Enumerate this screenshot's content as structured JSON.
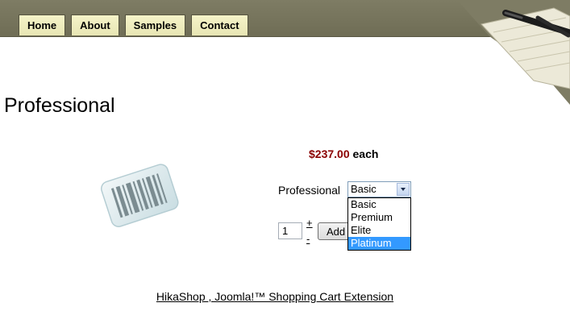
{
  "nav": {
    "items": [
      {
        "label": "Home"
      },
      {
        "label": "About"
      },
      {
        "label": "Samples"
      },
      {
        "label": "Contact"
      }
    ]
  },
  "page": {
    "title": "Professional"
  },
  "product": {
    "price": "$237.00",
    "price_suffix": "each",
    "variant_label": "Professional",
    "selected_variant": "Basic",
    "variant_options": [
      "Basic",
      "Premium",
      "Elite",
      "Platinum"
    ],
    "highlighted_option": "Platinum",
    "quantity": "1",
    "plus_label": "+",
    "minus_label": "-",
    "add_button_label": "Add to cart"
  },
  "footer": {
    "link_text": "HikaShop , Joomla!™ Shopping Cart Extension"
  },
  "colors": {
    "header_bg": "#7e7c64",
    "nav_tab_bg": "#f5f3c8",
    "price": "#8b0000",
    "option_highlight": "#3399ff"
  },
  "icons": {
    "header_art": "notepad-pen-icon",
    "product_image": "barcode-icon"
  }
}
